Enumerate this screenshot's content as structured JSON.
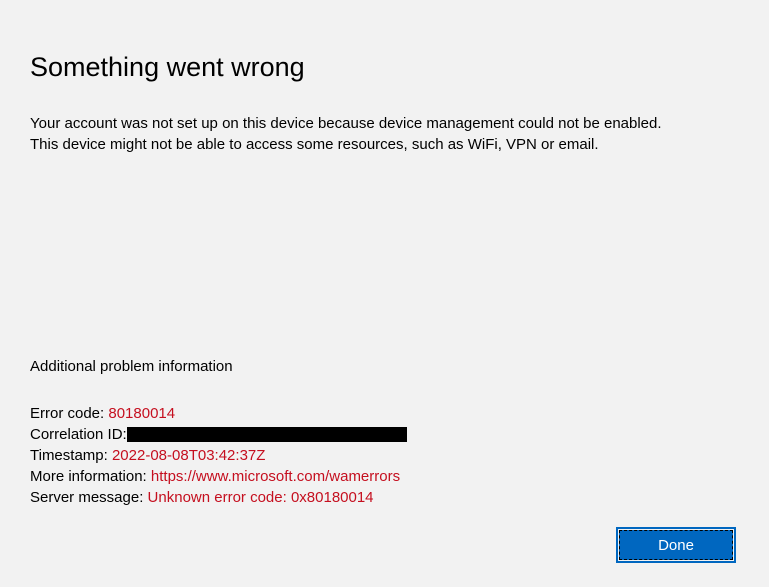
{
  "title": "Something went wrong",
  "description": "Your account was not set up on this device because device management could not be enabled. This device might not be able to access some resources, such as WiFi, VPN or email.",
  "additional": {
    "heading": "Additional problem information",
    "error_code_label": "Error code: ",
    "error_code_value": "80180014",
    "correlation_label": "Correlation ID:",
    "timestamp_label": "Timestamp: ",
    "timestamp_value": "2022-08-08T03:42:37Z",
    "more_info_label": "More information: ",
    "more_info_link": "https://www.microsoft.com/wamerrors",
    "server_msg_label": "Server message: ",
    "server_msg_value": "Unknown error code: 0x80180014"
  },
  "done_button": "Done"
}
